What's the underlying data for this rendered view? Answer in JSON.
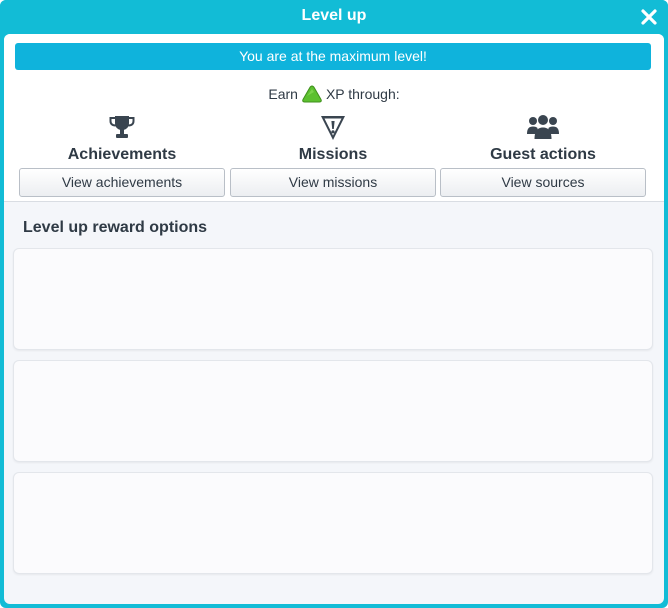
{
  "window": {
    "title": "Level up",
    "close_icon": "close-icon"
  },
  "banner": {
    "text": "You are at the maximum level!",
    "color": "#0fb3dc"
  },
  "earn": {
    "prefix": "Earn",
    "icon": "xp-triangle-icon",
    "suffix": "XP through:"
  },
  "sources": [
    {
      "icon": "trophy-icon",
      "label": "Achievements",
      "button": "View achievements"
    },
    {
      "icon": "mission-warning-icon",
      "label": "Missions",
      "button": "View missions"
    },
    {
      "icon": "guests-group-icon",
      "label": "Guest actions",
      "button": "View sources"
    }
  ],
  "rewards": {
    "title": "Level up reward options",
    "cards": [
      "",
      "",
      ""
    ]
  },
  "colors": {
    "accent": "#12bcd6",
    "text": "#2f3a45",
    "xp_green": "#5cc02f"
  }
}
